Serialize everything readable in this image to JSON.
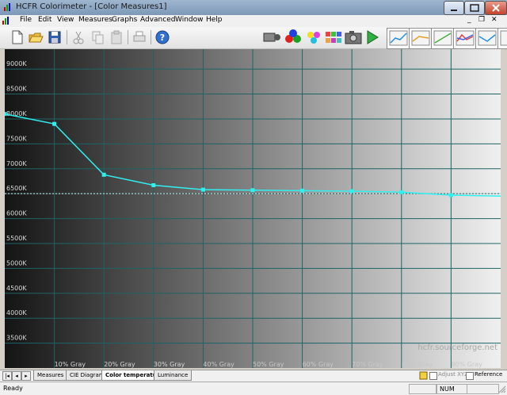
{
  "window": {
    "title": "HCFR Colorimeter - [Color Measures1]"
  },
  "menu": [
    "File",
    "Edit",
    "View",
    "Measures",
    "Graphs",
    "Advanced",
    "Window",
    "Help"
  ],
  "colors": {
    "curve": "#2ff0f0",
    "grid": "#1e6464",
    "label": "#d8d8d8",
    "reference": "#e8e8e8"
  },
  "chart_data": {
    "type": "line",
    "y_ticks": [
      "9000K",
      "8500K",
      "8000K",
      "7500K",
      "7000K",
      "6500K",
      "6000K",
      "5500K",
      "5000K",
      "4500K",
      "4000K",
      "3500K"
    ],
    "x_ticks": [
      "10% Gray",
      "20% Gray",
      "30% Gray",
      "40% Gray",
      "50% Gray",
      "60% Gray",
      "70% Gray",
      "80% Gray",
      "90% Gray"
    ],
    "ylim": [
      3000,
      9400
    ],
    "x": [
      0,
      10,
      20,
      30,
      40,
      50,
      60,
      70,
      80,
      90,
      100
    ],
    "series": [
      {
        "values": [
          8100,
          7900,
          6880,
          6670,
          6580,
          6570,
          6560,
          6550,
          6530,
          6470,
          6450
        ]
      }
    ],
    "reference_value": 6500,
    "watermark": "hcfr.sourceforge.net"
  },
  "tabs": {
    "items": [
      "Measures",
      "CIE Diagram",
      "Color temperature",
      "Luminance"
    ],
    "active": 2
  },
  "options": {
    "adjust": "Adjust XYZ",
    "reference": "Reference"
  },
  "status": {
    "ready": "Ready",
    "num": "NUM"
  },
  "icons": [
    "new-icon",
    "open-icon",
    "save-icon",
    "cut-icon",
    "copy-icon",
    "paste-icon",
    "print-icon",
    "help-icon",
    "sensor-icon",
    "rgb-measure-icon",
    "color-measure-icon",
    "satur-measure-icon",
    "camera-icon",
    "play-icon",
    "graph1-icon",
    "graph2-icon",
    "graph3-icon",
    "graph4-icon",
    "graph5-icon",
    "graph6-icon"
  ]
}
